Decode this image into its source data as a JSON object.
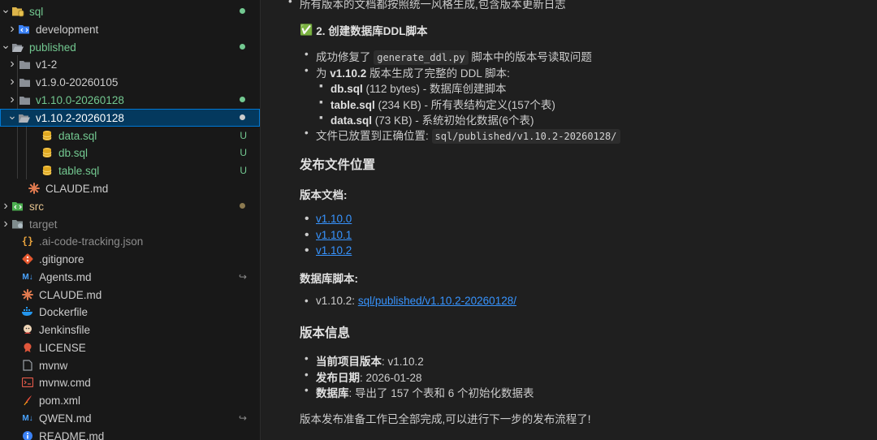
{
  "explorer": {
    "items": [
      {
        "label": "sql",
        "chev": "open",
        "icon": "folder-sql-icon",
        "color": "#73c991",
        "decor": "dot",
        "decorColor": "#73c991"
      },
      {
        "label": "development",
        "chev": "closed",
        "icon": "folder-code-icon",
        "color": "#cccccc"
      },
      {
        "label": "published",
        "chev": "open",
        "icon": "folder-open-icon",
        "color": "#73c991",
        "decor": "dot",
        "decorColor": "#73c991"
      },
      {
        "label": "v1-2",
        "chev": "closed",
        "icon": "folder-icon",
        "color": "#cccccc"
      },
      {
        "label": "v1.9.0-20260105",
        "chev": "closed",
        "icon": "folder-icon",
        "color": "#cccccc"
      },
      {
        "label": "v1.10.0-20260128",
        "chev": "closed",
        "icon": "folder-icon",
        "color": "#73c991",
        "decor": "dot",
        "decorColor": "#73c991"
      },
      {
        "label": "v1.10.2-20260128",
        "chev": "open",
        "icon": "folder-open-icon",
        "color": "#ffffff",
        "decor": "dot",
        "decorColor": "#cccccc"
      },
      {
        "label": "data.sql",
        "icon": "database-icon",
        "color": "#73c991",
        "decor": "U",
        "decorColor": "#73c991"
      },
      {
        "label": "db.sql",
        "icon": "database-icon",
        "color": "#73c991",
        "decor": "U",
        "decorColor": "#73c991"
      },
      {
        "label": "table.sql",
        "icon": "database-icon",
        "color": "#73c991",
        "decor": "U",
        "decorColor": "#73c991"
      },
      {
        "label": "CLAUDE.md",
        "icon": "claude-icon",
        "color": "#cccccc"
      },
      {
        "label": "src",
        "chev": "closed",
        "icon": "folder-src-icon",
        "color": "#e2c08d",
        "decor": "dot",
        "decorColor": "#8c7a50"
      },
      {
        "label": "target",
        "chev": "closed",
        "icon": "folder-target-icon",
        "color": "#8c8c8c"
      },
      {
        "label": ".ai-code-tracking.json",
        "icon": "json-icon",
        "color": "#8c8c8c"
      },
      {
        "label": ".gitignore",
        "icon": "git-icon",
        "color": "#cccccc"
      },
      {
        "label": "Agents.md",
        "icon": "markdown-icon",
        "color": "#cccccc",
        "decor": "↪",
        "decorColor": "#8c8c8c"
      },
      {
        "label": "CLAUDE.md",
        "icon": "claude-icon",
        "color": "#cccccc"
      },
      {
        "label": "Dockerfile",
        "icon": "docker-icon",
        "color": "#cccccc"
      },
      {
        "label": "Jenkinsfile",
        "icon": "jenkins-icon",
        "color": "#cccccc"
      },
      {
        "label": "LICENSE",
        "icon": "license-icon",
        "color": "#cccccc"
      },
      {
        "label": "mvnw",
        "icon": "file-icon",
        "color": "#cccccc"
      },
      {
        "label": "mvnw.cmd",
        "icon": "terminal-icon",
        "color": "#cccccc"
      },
      {
        "label": "pom.xml",
        "icon": "maven-icon",
        "color": "#cccccc"
      },
      {
        "label": "QWEN.md",
        "icon": "markdown-icon",
        "color": "#cccccc",
        "decor": "↪",
        "decorColor": "#8c8c8c"
      },
      {
        "label": "README.md",
        "icon": "info-icon",
        "color": "#cccccc"
      }
    ]
  },
  "content": {
    "top_line": "所有版本的文档都按照统一风格生成,包含版本更新日志",
    "section2": {
      "check": "✅",
      "title": "2. 创建数据库DDL脚本",
      "fix_pre": "成功修复了",
      "fix_code": "generate_ddl.py",
      "fix_post": "脚本中的版本号读取问题",
      "gen_pre": "为",
      "gen_version": "v1.10.2",
      "gen_post": "版本生成了完整的 DDL 脚本:",
      "files": [
        {
          "name": "db.sql",
          "detail": "(112 bytes) - 数据库创建脚本"
        },
        {
          "name": "table.sql",
          "detail": "(234 KB) - 所有表结构定义(157个表)"
        },
        {
          "name": "data.sql",
          "detail": "(73 KB) - 系统初始化数据(6个表)"
        }
      ],
      "placed_pre": "文件已放置到正确位置:",
      "placed_code": "sql/published/v1.10.2-20260128/"
    },
    "release_location": {
      "title": "发布文件位置",
      "docs_label": "版本文档:",
      "docs_links": [
        "v1.10.0",
        "v1.10.1",
        "v1.10.2"
      ],
      "db_label": "数据库脚本:",
      "db_prefix": "v1.10.2:",
      "db_link": "sql/published/v1.10.2-20260128/"
    },
    "version_info": {
      "title": "版本信息",
      "rows": [
        {
          "key": "当前项目版本",
          "value": ": v1.10.2"
        },
        {
          "key": "发布日期",
          "value": ": 2026-01-28"
        },
        {
          "key": "数据库",
          "value": ": 导出了 157 个表和 6 个初始化数据表"
        }
      ]
    },
    "closing": "版本发布准备工作已全部完成,可以进行下一步的发布流程了!"
  }
}
